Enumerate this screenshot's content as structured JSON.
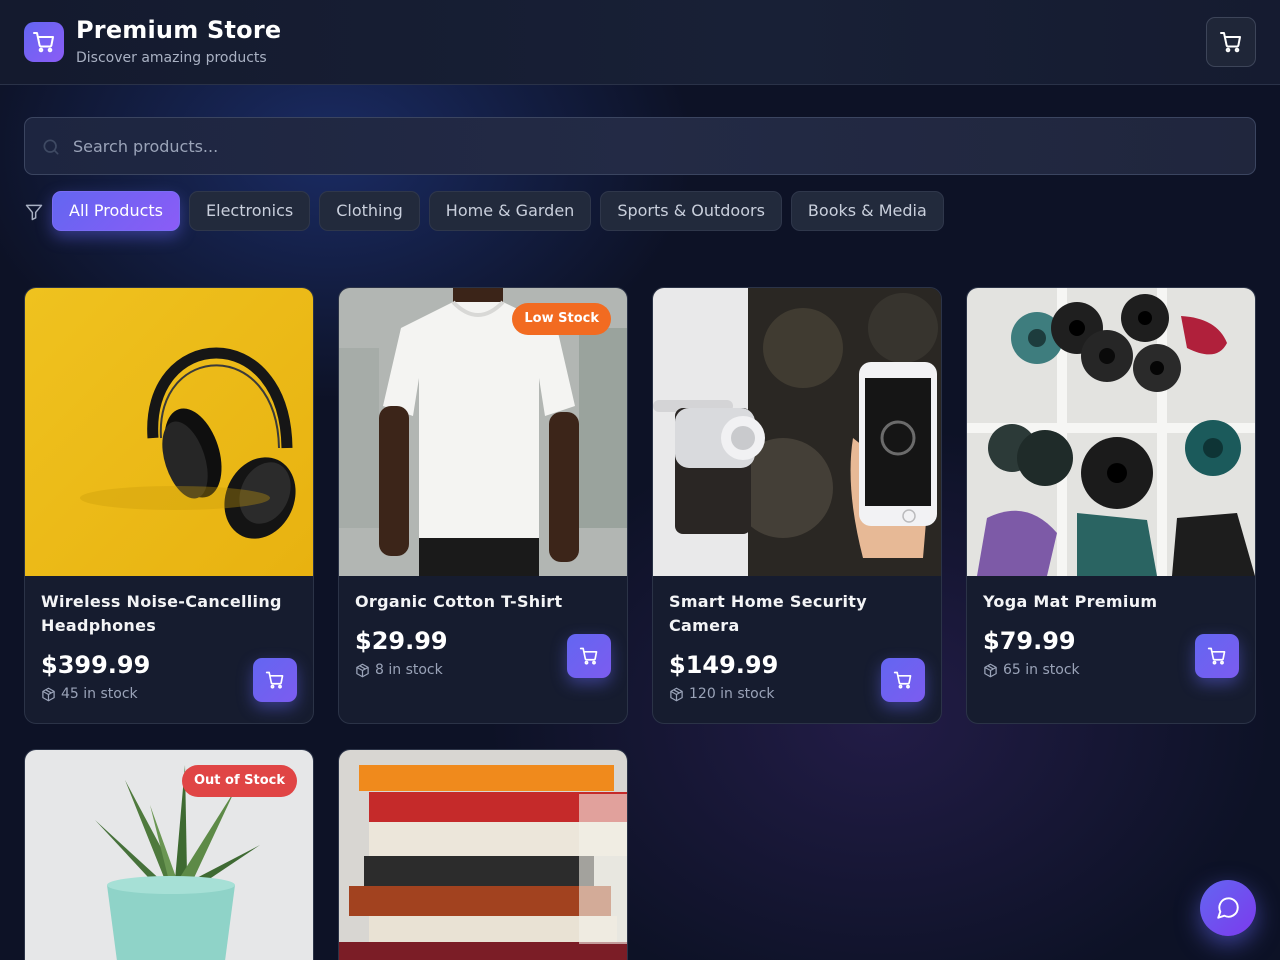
{
  "header": {
    "title": "Premium Store",
    "subtitle": "Discover amazing products",
    "logo_icon": "cart-icon",
    "cart_icon": "cart-icon"
  },
  "search": {
    "placeholder": "Search products...",
    "value": ""
  },
  "filters": {
    "icon": "filter-icon",
    "categories": [
      {
        "label": "All Products",
        "active": true
      },
      {
        "label": "Electronics",
        "active": false
      },
      {
        "label": "Clothing",
        "active": false
      },
      {
        "label": "Home & Garden",
        "active": false
      },
      {
        "label": "Sports & Outdoors",
        "active": false
      },
      {
        "label": "Books & Media",
        "active": false
      }
    ]
  },
  "products": [
    {
      "name": "Wireless Noise-Cancelling Headphones",
      "price": "$399.99",
      "stock": "45 in stock",
      "badge": "",
      "image": "headphones-photo"
    },
    {
      "name": "Organic Cotton T-Shirt",
      "price": "$29.99",
      "stock": "8 in stock",
      "badge": "Low Stock",
      "image": "tshirt-photo"
    },
    {
      "name": "Smart Home Security Camera",
      "price": "$149.99",
      "stock": "120 in stock",
      "badge": "",
      "image": "smart-lock-photo"
    },
    {
      "name": "Yoga Mat Premium",
      "price": "$79.99",
      "stock": "65 in stock",
      "badge": "",
      "image": "yoga-mats-photo"
    },
    {
      "name": "",
      "price": "",
      "stock": "",
      "badge": "Out of Stock",
      "image": "succulent-plant-photo"
    },
    {
      "name": "",
      "price": "",
      "stock": "",
      "badge": "",
      "image": "books-stack-photo"
    }
  ],
  "colors": {
    "background": "#0d1226",
    "accent": "#6366f1",
    "accent_secondary": "#8b5cf6",
    "low_stock": "#f26b21",
    "out_of_stock": "#e04545"
  },
  "chat": {
    "icon": "chat-bubble-icon"
  }
}
